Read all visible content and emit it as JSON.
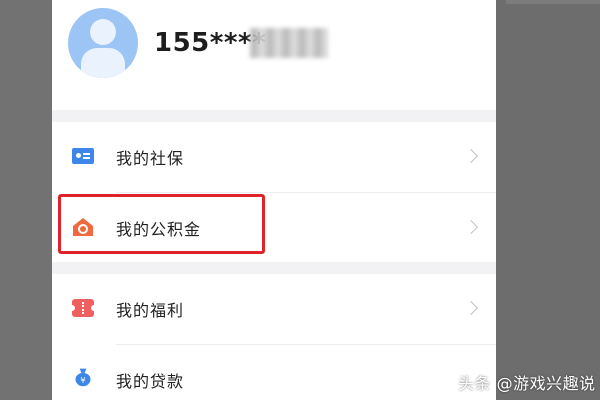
{
  "profile": {
    "phone_number": "155****",
    "avatar_icon": "user-avatar-icon"
  },
  "menu": {
    "group_1": [
      {
        "label": "我的社保",
        "icon": "id-card-icon",
        "icon_color": "#3e87ea"
      },
      {
        "label": "我的公积金",
        "icon": "house-icon",
        "icon_color": "#ef6a3e"
      }
    ],
    "group_2": [
      {
        "label": "我的福利",
        "icon": "ticket-icon",
        "icon_color": "#ef5f5f"
      },
      {
        "label": "我的贷款",
        "icon": "money-bag-icon",
        "icon_color": "#3e87ea"
      }
    ]
  },
  "highlight_color": "#e0232a",
  "watermark": "头条 @游戏兴趣说"
}
